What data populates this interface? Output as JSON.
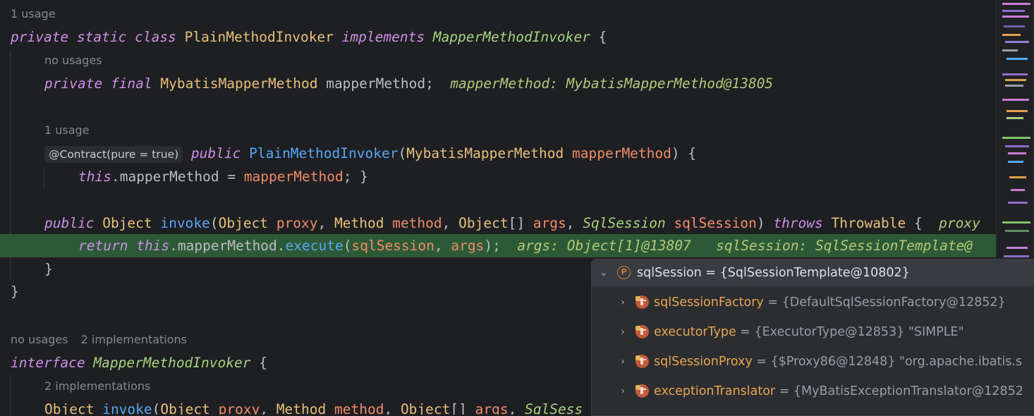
{
  "editor": {
    "hint_1": "1 usage",
    "line_class_decl": {
      "private": "private",
      "static": "static",
      "class": "class",
      "name": "PlainMethodInvoker",
      "implements": "implements",
      "iface": "MapperMethodInvoker",
      "brace": "{"
    },
    "hint_2": "no usages",
    "line_field": {
      "private": "private",
      "final": "final",
      "type": "MybatisMapperMethod",
      "name": "mapperMethod;",
      "inline_value": "mapperMethod: MybatisMapperMethod@13805"
    },
    "hint_3": "1 usage",
    "line_ctor": {
      "annotation": "@Contract(pure = true)",
      "public": "public",
      "name": "PlainMethodInvoker",
      "open": "(",
      "ptype": "MybatisMapperMethod",
      "pname": "mapperMethod",
      "close": ") {"
    },
    "line_ctor_body": {
      "this": "this",
      "field": ".mapperMethod = ",
      "value": "mapperMethod",
      "end": "; }"
    },
    "line_invoke": {
      "public": "public",
      "rtype": "Object",
      "name": "invoke",
      "open": "(",
      "t1": "Object",
      "p1": "proxy",
      "c1": ", ",
      "t2": "Method",
      "p2": "method",
      "c2": ", ",
      "t3": "Object",
      "arr": "[] ",
      "p3": "args",
      "c3": ", ",
      "t4": "SqlSession",
      "p4": "sqlSession",
      "close": ") ",
      "throws": "throws",
      "exc": "Throwable",
      "brace": " {",
      "inline_value": "proxy"
    },
    "line_return": {
      "return": "return",
      "this": "this",
      "field": ".mapperMethod.",
      "call": "execute",
      "open": "(",
      "a1": "sqlSession",
      "comma": ", ",
      "a2": "args",
      "close": ");",
      "inline_args": "args: Object[1]@13807",
      "inline_session": "sqlSession: SqlSessionTemplate@"
    },
    "line_close_method": "}",
    "line_close_class": "}",
    "hint_4a": "no usages",
    "hint_4b": "2 implementations",
    "line_interface": {
      "interface": "interface",
      "name": "MapperMethodInvoker",
      "brace": "{"
    },
    "hint_5": "2 implementations",
    "line_iface_method": {
      "rtype": "Object",
      "name": "invoke",
      "open": "(",
      "t1": "Object",
      "p1": "proxy",
      "c1": ", ",
      "t2": "Method",
      "p2": "method",
      "c2": ", ",
      "t3": "Object",
      "arr": "[] ",
      "p3": "args",
      "c3": ", ",
      "t4": "SqlSess"
    }
  },
  "debug_popup": {
    "root": {
      "icon": "p-icon",
      "name": "sqlSession",
      "value": " = {SqlSessionTemplate@10802}"
    },
    "fields": [
      {
        "name": "sqlSessionFactory",
        "value": " = {DefaultSqlSessionFactory@12852}"
      },
      {
        "name": "executorType",
        "value": " = {ExecutorType@12853} \"SIMPLE\""
      },
      {
        "name": "sqlSessionProxy",
        "value": " = {$Proxy86@12848} \"org.apache.ibatis.s"
      },
      {
        "name": "exceptionTranslator",
        "value": " = {MyBatisExceptionTranslator@12852"
      }
    ]
  },
  "colors": {
    "background": "#1e1f22",
    "execution_line": "#2d5a36",
    "keyword": "#cf8ee8",
    "class": "#e8c07a",
    "parameter": "#f08d69",
    "method": "#56a8f5"
  }
}
